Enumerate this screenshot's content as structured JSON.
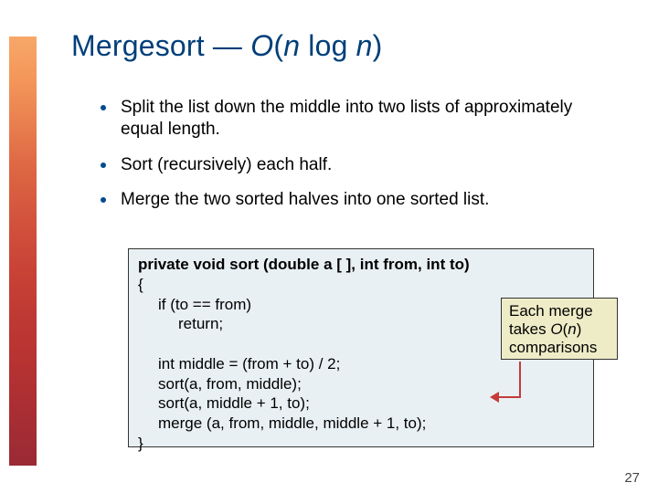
{
  "title": {
    "text_parts": [
      "Mergesort — ",
      "O",
      "(",
      "n",
      " log ",
      "n",
      ")"
    ]
  },
  "bullets": [
    "Split the list down the middle into two lists of approximately equal length.",
    "Sort (recursively) each half.",
    "Merge the two sorted halves into one sorted list."
  ],
  "code": {
    "sig": "private void sort (double a [ ], int from, int to)",
    "l1": "{",
    "l2": "if (to == from)",
    "l3": "return;",
    "l5": "int middle = (from + to) / 2;",
    "l6": "sort(a, from, middle);",
    "l7": "sort(a, middle + 1, to);",
    "l8": "merge (a, from, middle, middle + 1, to);",
    "l9": "}"
  },
  "note": {
    "line1": "Each merge",
    "line2a": "takes ",
    "line2b": "O",
    "line2c": "(",
    "line2d": "n",
    "line2e": ")",
    "line3": "comparisons"
  },
  "page_number": "27",
  "colors": {
    "title": "#003f7a",
    "bullet_dot": "#004b8d",
    "code_bg": "#e9f0f3",
    "note_bg": "#eeecc7",
    "arrow": "#c53a3a"
  }
}
